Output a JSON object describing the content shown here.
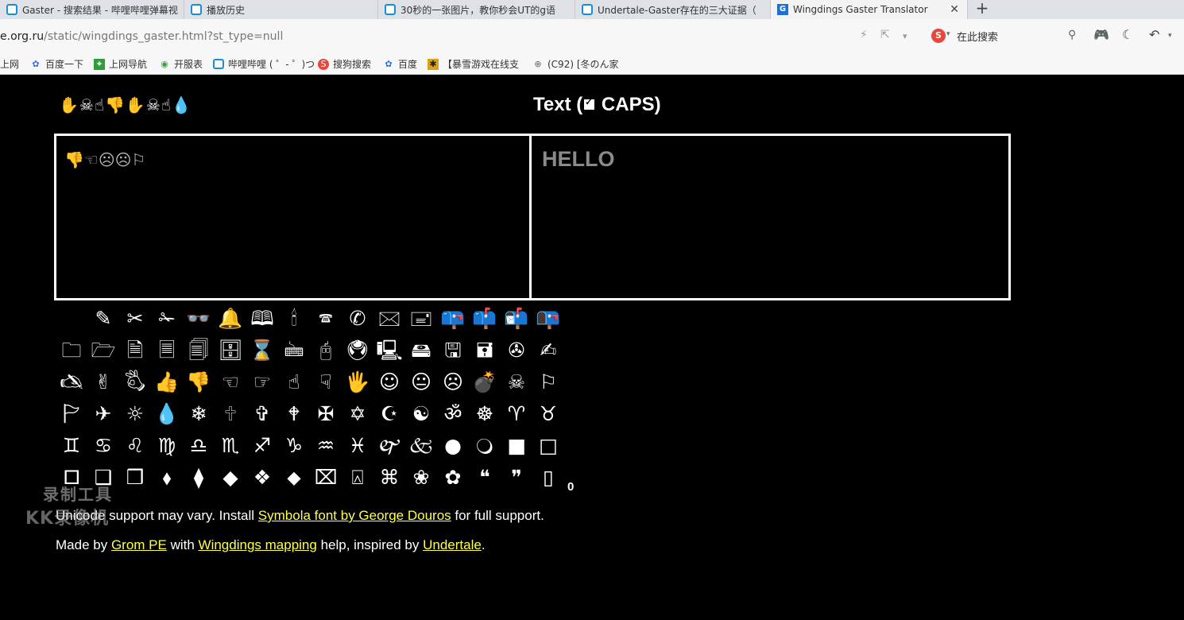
{
  "browser": {
    "tabs": [
      {
        "title": "Gaster - 搜索结果 - 哔哩哔哩弹幕视",
        "favicon": "bilibili-icon",
        "active": false
      },
      {
        "title": "播放历史",
        "favicon": "bilibili-icon",
        "active": false
      },
      {
        "title": "30秒的一张图片，教你秒会UT的g语",
        "favicon": "bilibili-icon",
        "active": false
      },
      {
        "title": "Undertale-Gaster存在的三大证据（",
        "favicon": "bilibili-icon",
        "active": false
      },
      {
        "title": "Wingdings Gaster Translator",
        "favicon": "g-site-icon",
        "active": true
      }
    ],
    "new_tab": "+",
    "url_host": "e.org.ru",
    "url_path": "/static/wingdings_gaster.html?st_type=null",
    "search_engine_letter": "S",
    "search_placeholder": "在此搜索",
    "bookmarks": [
      {
        "label": "上网",
        "icon": "globe-icon"
      },
      {
        "label": "百度一下",
        "icon": "baidu-paw-icon"
      },
      {
        "label": "上网导航",
        "icon": "nav-icon"
      },
      {
        "label": "开服表",
        "icon": "gamepad-icon"
      },
      {
        "label": "哔哩哔哩 ( ゜- ゜)つ",
        "icon": "bilibili-icon"
      },
      {
        "label": "搜狗搜索",
        "icon": "sogou-icon"
      },
      {
        "label": "百度",
        "icon": "baidu-paw-icon"
      },
      {
        "label": "【暴雪游戏在线支",
        "icon": "blizzard-icon"
      },
      {
        "label": "(C92) [冬のん家",
        "icon": "globe-icon"
      }
    ]
  },
  "translator": {
    "wingdings_title": "✋☠☝👎✋☠☝💧",
    "text_title_prefix": "Text (",
    "caps_label": "CAPS)",
    "caps_checked": true,
    "wingdings_output": "👎☜☹☹⚐",
    "text_input": "HELLO",
    "keypad_symbols": [
      "✎",
      "✂",
      "✁",
      "👓",
      "🔔",
      "🕮",
      "🕯",
      "🕿",
      "✆",
      "🖂",
      "🖃",
      "📪",
      "📫",
      "📬",
      "📭",
      "🗀",
      "🗁",
      "🗎",
      "🗏",
      "🗐",
      "🗄",
      "⌛",
      "🖮",
      "🖰",
      "🖲",
      "🖳",
      "🖴",
      "🖫",
      "🖬",
      "✇",
      "✍",
      "🖎",
      "✌",
      "🖏",
      "👍",
      "👎",
      "☜",
      "☞",
      "☝",
      "☟",
      "🖐",
      "☺",
      "😐",
      "☹",
      "💣",
      "☠",
      "⚐",
      "🏱",
      "✈",
      "☼",
      "💧",
      "❄",
      "🕆",
      "✞",
      "🕈",
      "✠",
      "✡",
      "☪",
      "☯",
      "ॐ",
      "☸",
      "♈",
      "♉",
      "♊",
      "♋",
      "♌",
      "♍",
      "♎",
      "♏",
      "♐",
      "♑",
      "♒",
      "♓",
      "🙰",
      "🙵",
      "●",
      "🔾",
      "■",
      "□",
      "🞐",
      "❑",
      "❒",
      "⬧",
      "⧫",
      "◆",
      "❖",
      "⬥",
      "⌧",
      "⍓",
      "⌘",
      "❀",
      "✿",
      "❝",
      "❞",
      "▯"
    ],
    "char_count": "0",
    "footer_line1": {
      "before": "Unicode support may vary. Install ",
      "link": "Symbola font by George Douros",
      "after": " for full support."
    },
    "footer_line2": {
      "before": "Made by ",
      "link1": "Grom PE",
      "mid1": " with ",
      "link2": "Wingdings mapping",
      "mid2": " help, inspired by ",
      "link3": "Undertale",
      "after": "."
    },
    "link_color": "#ffff4a"
  },
  "watermark": {
    "line1": "录制工具",
    "line2": "KK录像机"
  }
}
